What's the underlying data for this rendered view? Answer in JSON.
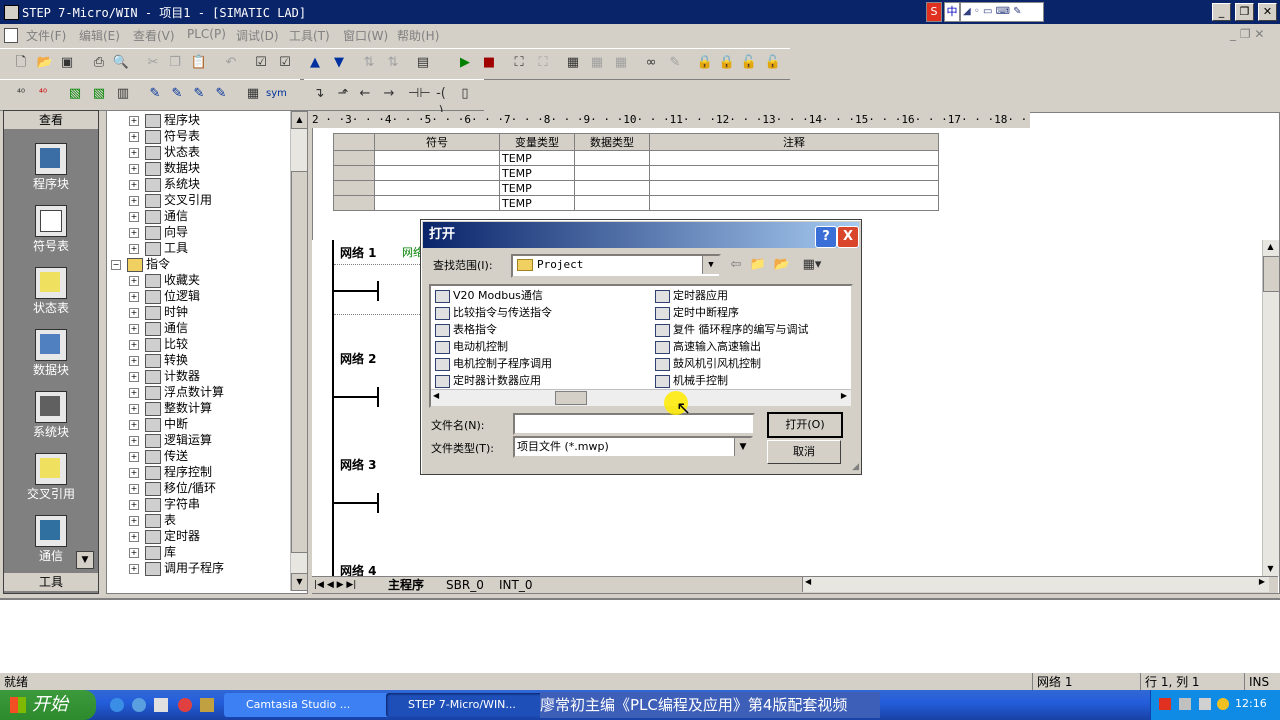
{
  "window": {
    "title": "STEP 7-Micro/WIN - 项目1 - [SIMATIC LAD]"
  },
  "ime": {
    "s": "S",
    "zh": "中"
  },
  "menu": [
    "文件(F)",
    "编辑(E)",
    "查看(V)",
    "PLC(P)",
    "调试(D)",
    "工具(T)",
    "窗口(W)",
    "帮助(H)"
  ],
  "viewbar": {
    "header": "查看",
    "footer": "工具",
    "items": [
      "程序块",
      "符号表",
      "状态表",
      "数据块",
      "系统块",
      "交叉引用",
      "通信"
    ]
  },
  "tree": {
    "project_items": [
      "程序块",
      "符号表",
      "状态表",
      "数据块",
      "系统块",
      "交叉引用",
      "通信",
      "向导",
      "工具"
    ],
    "instructions_root": "指令",
    "instruction_items": [
      "收藏夹",
      "位逻辑",
      "时钟",
      "通信",
      "比较",
      "转换",
      "计数器",
      "浮点数计算",
      "整数计算",
      "中断",
      "逻辑运算",
      "传送",
      "程序控制",
      "移位/循环",
      "字符串",
      "表",
      "定时器",
      "库",
      "调用子程序"
    ]
  },
  "ruler": "2 · ·3· · ·4· · ·5· · ·6· · ·7· · ·8· · ·9· · ·10· · ·11· · ·12· · ·13· · ·14· · ·15· · ·16· · ·17· · ·18· · ·19· · ·20· ·",
  "var_table": {
    "headers": [
      "符号",
      "变量类型",
      "数据类型",
      "注释"
    ],
    "rows": [
      [
        "",
        "TEMP",
        "",
        ""
      ],
      [
        "",
        "TEMP",
        "",
        ""
      ],
      [
        "",
        "TEMP",
        "",
        ""
      ],
      [
        "",
        "TEMP",
        "",
        ""
      ]
    ]
  },
  "networks": [
    "网络 1",
    "网络 2",
    "网络 3",
    "网络 4"
  ],
  "network1_comment": "网络",
  "tabs": [
    "主程序",
    "SBR_0",
    "INT_0"
  ],
  "dialog": {
    "title": "打开",
    "help": "?",
    "close": "X",
    "lookin_label": "查找范围(I):",
    "lookin_value": "Project",
    "files_col1": [
      "V20 Modbus通信",
      "比较指令与传送指令",
      "表格指令",
      "电动机控制",
      "电机控制子程序调用",
      "定时器计数器应用"
    ],
    "files_col2": [
      "定时器应用",
      "定时中断程序",
      "复件 循环程序的编写与调试",
      "高速输入高速输出",
      "鼓风机引风机控制",
      "机械手控制"
    ],
    "filename_label": "文件名(N):",
    "filename_value": "",
    "filetype_label": "文件类型(T):",
    "filetype_value": "项目文件 (*.mwp)",
    "open_button": "打开(O)",
    "cancel_button": "取消"
  },
  "status": {
    "left": "就绪",
    "network": "网络 1",
    "position": "行 1, 列 1",
    "mode": "INS"
  },
  "taskbar": {
    "start": "开始",
    "tasks": [
      "Camtasia Studio ...",
      "STEP 7-Micro/WIN..."
    ],
    "caption": "廖常初主编《PLC编程及应用》第4版配套视频",
    "clock": "12:16"
  }
}
